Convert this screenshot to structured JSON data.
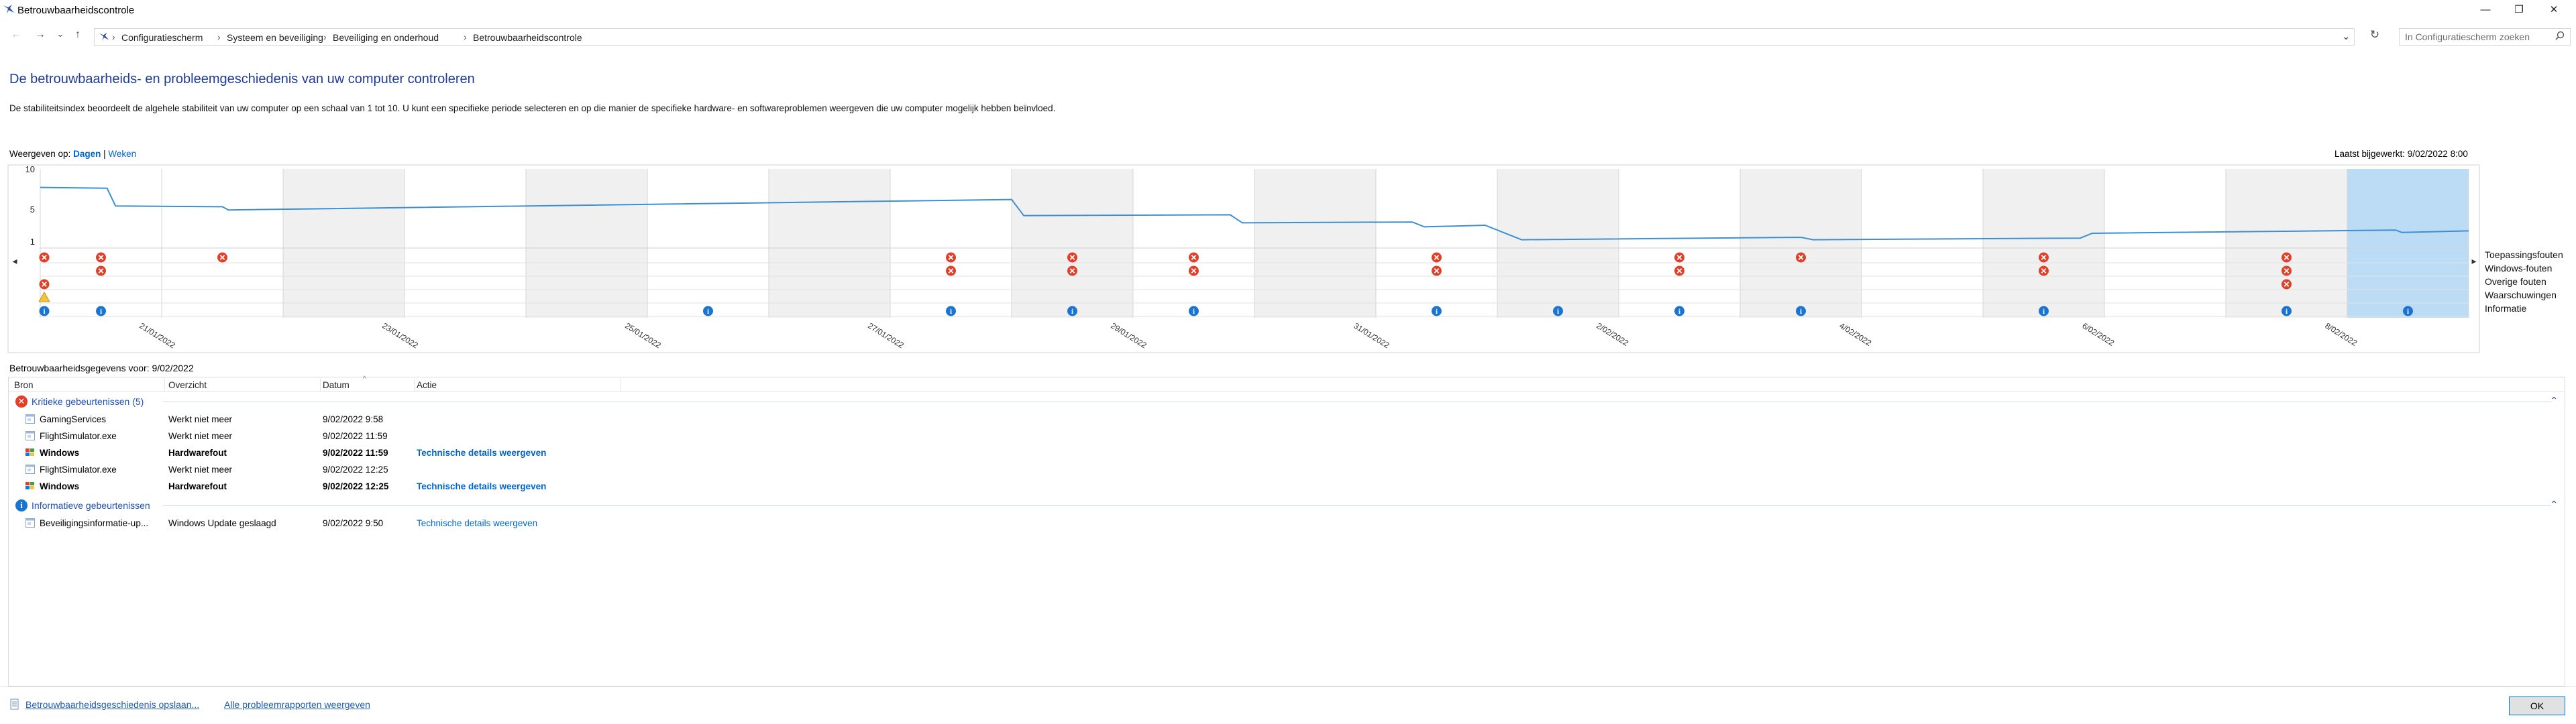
{
  "window": {
    "title": "Betrouwbaarheidscontrole",
    "minimize": "—",
    "maximize": "❐",
    "close": "✕"
  },
  "nav": {
    "back": "←",
    "forward": "→",
    "recent": "⌄",
    "up": "↑",
    "refresh": "↻",
    "dropdown": "⌄"
  },
  "breadcrumb": [
    "Configuratiescherm",
    "Systeem en beveiliging",
    "Beveiliging en onderhoud",
    "Betrouwbaarheidscontrole"
  ],
  "search": {
    "placeholder": "In Configuratiescherm zoeken"
  },
  "page": {
    "heading": "De betrouwbaarheids- en probleemgeschiedenis van uw computer controleren",
    "description": "De stabiliteitsindex beoordeelt de algehele stabiliteit van uw computer op een schaal van 1 tot 10. U kunt een specifieke periode selecteren en op die manier de specifieke hardware- en softwareproblemen weergeven die uw computer mogelijk hebben beïnvloed.",
    "view_label": "Weergeven op:",
    "view_days": "Dagen",
    "view_sep": "|",
    "view_weeks": "Weken",
    "last_updated": "Laatst bijgewerkt: 9/02/2022 8:00"
  },
  "chart_data": {
    "type": "line",
    "ylim": [
      1,
      10
    ],
    "yticks": [
      "10",
      "5",
      "1"
    ],
    "columns": 20,
    "date_labels": [
      {
        "col": 1,
        "text": "21/01/2022"
      },
      {
        "col": 3,
        "text": "23/01/2022"
      },
      {
        "col": 5,
        "text": "25/01/2022"
      },
      {
        "col": 7,
        "text": "27/01/2022"
      },
      {
        "col": 9,
        "text": "29/01/2022"
      },
      {
        "col": 11,
        "text": "31/01/2022"
      },
      {
        "col": 13,
        "text": "2/02/2022"
      },
      {
        "col": 15,
        "text": "4/02/2022"
      },
      {
        "col": 17,
        "text": "6/02/2022"
      },
      {
        "col": 19,
        "text": "8/02/2022"
      }
    ],
    "stability_series": {
      "name": "Stabiliteitsindex",
      "points": [
        [
          0,
          7.7
        ],
        [
          0.55,
          7.6
        ],
        [
          0.62,
          5.4
        ],
        [
          1.5,
          5.3
        ],
        [
          1.55,
          4.9
        ],
        [
          8.0,
          6.2
        ],
        [
          8.1,
          4.2
        ],
        [
          9.8,
          4.3
        ],
        [
          9.9,
          3.3
        ],
        [
          11.3,
          3.4
        ],
        [
          11.4,
          2.8
        ],
        [
          11.9,
          3.0
        ],
        [
          12.2,
          1.2
        ],
        [
          14.5,
          1.5
        ],
        [
          14.6,
          1.2
        ],
        [
          16.8,
          1.4
        ],
        [
          16.9,
          2.0
        ],
        [
          19.4,
          2.4
        ],
        [
          19.45,
          2.1
        ],
        [
          20,
          2.3
        ]
      ]
    },
    "event_rows": [
      "Toepassingsfouten",
      "Windows-fouten",
      "Overige fouten",
      "Waarschuwingen",
      "Informatie"
    ],
    "events": [
      {
        "row": 0,
        "cols": [
          0,
          0.5,
          1.5,
          7.5,
          8.5,
          9.5,
          11.5,
          13.5,
          14.5,
          16.5,
          18.5
        ]
      },
      {
        "row": 1,
        "cols": [
          0.5,
          7.5,
          8.5,
          9.5,
          11.5,
          13.5,
          16.5,
          18.5
        ]
      },
      {
        "row": 2,
        "cols": [
          0,
          18.5
        ]
      },
      {
        "row": 3,
        "cols": [
          0
        ]
      },
      {
        "row": 4,
        "cols": [
          0,
          0.5,
          5.5,
          7.5,
          8.5,
          9.5,
          11.5,
          12.5,
          13.5,
          14.5,
          16.5,
          18.5,
          19.5
        ]
      }
    ],
    "shaded_columns": [
      2,
      4,
      6,
      8,
      10,
      12,
      14,
      16,
      18
    ],
    "selected_column": 19,
    "colors": {
      "line": "#3b8fd6",
      "error": "#e0402a",
      "warning": "#f3c43b",
      "info": "#1a74d1",
      "selected": "#bcdcf5",
      "shaded": "#f0f0f0"
    }
  },
  "details": {
    "header": "Betrouwbaarheidsgegevens voor: 9/02/2022",
    "columns": [
      "Bron",
      "Overzicht",
      "Datum",
      "Actie"
    ],
    "groups": [
      {
        "label": "Kritieke gebeurtenissen (5)",
        "icon": "error-icon",
        "rows": [
          {
            "source": "GamingServices",
            "summary": "Werkt niet meer",
            "date": "9/02/2022 9:58",
            "action": "",
            "bold": false
          },
          {
            "source": "FlightSimulator.exe",
            "summary": "Werkt niet meer",
            "date": "9/02/2022 11:59",
            "action": "",
            "bold": false
          },
          {
            "source": "Windows",
            "summary": "Hardwarefout",
            "date": "9/02/2022 11:59",
            "action": "Technische details weergeven",
            "bold": true
          },
          {
            "source": "FlightSimulator.exe",
            "summary": "Werkt niet meer",
            "date": "9/02/2022 12:25",
            "action": "",
            "bold": false
          },
          {
            "source": "Windows",
            "summary": "Hardwarefout",
            "date": "9/02/2022 12:25",
            "action": "Technische details weergeven",
            "bold": true
          }
        ]
      },
      {
        "label": "Informatieve gebeurtenissen",
        "icon": "info-icon",
        "rows": [
          {
            "source": "Beveiligingsinformatie-up...",
            "summary": "Windows Update geslaagd",
            "date": "9/02/2022 9:50",
            "action": "Technische details weergeven",
            "bold": false
          }
        ]
      }
    ]
  },
  "footer": {
    "save_link": "Betrouwbaarheidsgeschiedenis opslaan...",
    "reports_link": "Alle probleemrapporten weergeven",
    "ok": "OK"
  }
}
